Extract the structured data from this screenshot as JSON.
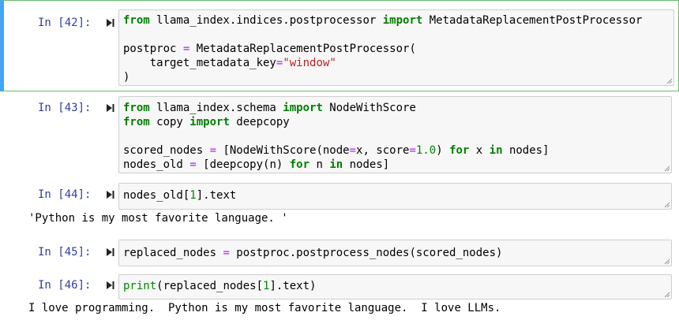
{
  "cells": [
    {
      "prompt": "In [42]:",
      "lines": [
        {
          "parts": [
            [
              "k",
              "from"
            ],
            [
              "t",
              " llama_index.indices.postprocessor "
            ],
            [
              "k",
              "import"
            ],
            [
              "t",
              " MetadataReplacementPostProcessor"
            ]
          ]
        },
        {
          "parts": []
        },
        {
          "parts": [
            [
              "t",
              "postproc "
            ],
            [
              "o",
              "="
            ],
            [
              "t",
              " MetadataReplacementPostProcessor("
            ]
          ]
        },
        {
          "parts": [
            [
              "t",
              "    target_metadata_key"
            ],
            [
              "o",
              "="
            ],
            [
              "s",
              "\"window\""
            ]
          ]
        },
        {
          "parts": [
            [
              "t",
              ")"
            ]
          ]
        }
      ]
    },
    {
      "prompt": "In [43]:",
      "lines": [
        {
          "parts": [
            [
              "k",
              "from"
            ],
            [
              "t",
              " llama_index.schema "
            ],
            [
              "k",
              "import"
            ],
            [
              "t",
              " NodeWithScore"
            ]
          ]
        },
        {
          "parts": [
            [
              "k",
              "from"
            ],
            [
              "t",
              " copy "
            ],
            [
              "k",
              "import"
            ],
            [
              "t",
              " deepcopy"
            ]
          ]
        },
        {
          "parts": []
        },
        {
          "parts": [
            [
              "t",
              "scored_nodes "
            ],
            [
              "o",
              "="
            ],
            [
              "t",
              " [NodeWithScore(node"
            ],
            [
              "o",
              "="
            ],
            [
              "t",
              "x, score"
            ],
            [
              "o",
              "="
            ],
            [
              "n",
              "1.0"
            ],
            [
              "t",
              ") "
            ],
            [
              "k",
              "for"
            ],
            [
              "t",
              " x "
            ],
            [
              "k",
              "in"
            ],
            [
              "t",
              " nodes]"
            ]
          ]
        },
        {
          "parts": [
            [
              "t",
              "nodes_old "
            ],
            [
              "o",
              "="
            ],
            [
              "t",
              " [deepcopy(n) "
            ],
            [
              "k",
              "for"
            ],
            [
              "t",
              " n "
            ],
            [
              "k",
              "in"
            ],
            [
              "t",
              " nodes]"
            ]
          ]
        }
      ]
    },
    {
      "prompt": "In [44]:",
      "lines": [
        {
          "parts": [
            [
              "t",
              "nodes_old["
            ],
            [
              "n",
              "1"
            ],
            [
              "t",
              "].text"
            ]
          ]
        }
      ],
      "output": "'Python is my most favorite language. '"
    },
    {
      "prompt": "In [45]:",
      "lines": [
        {
          "parts": [
            [
              "t",
              "replaced_nodes "
            ],
            [
              "o",
              "="
            ],
            [
              "t",
              " postproc.postprocess_nodes(scored_nodes)"
            ]
          ]
        }
      ]
    },
    {
      "prompt": "In [46]:",
      "lines": [
        {
          "parts": [
            [
              "n",
              "print"
            ],
            [
              "t",
              "(replaced_nodes["
            ],
            [
              "n",
              "1"
            ],
            [
              "t",
              "].text)"
            ]
          ]
        }
      ],
      "output": "I love programming.  Python is my most favorite language.  I love LLMs."
    }
  ],
  "colors": {
    "prompt": "#303f9f",
    "keyword": "#008000",
    "operator": "#aa22ff",
    "string": "#ba2121",
    "selected_border": "#66bb6a",
    "selected_edge": "#42a5f5"
  }
}
